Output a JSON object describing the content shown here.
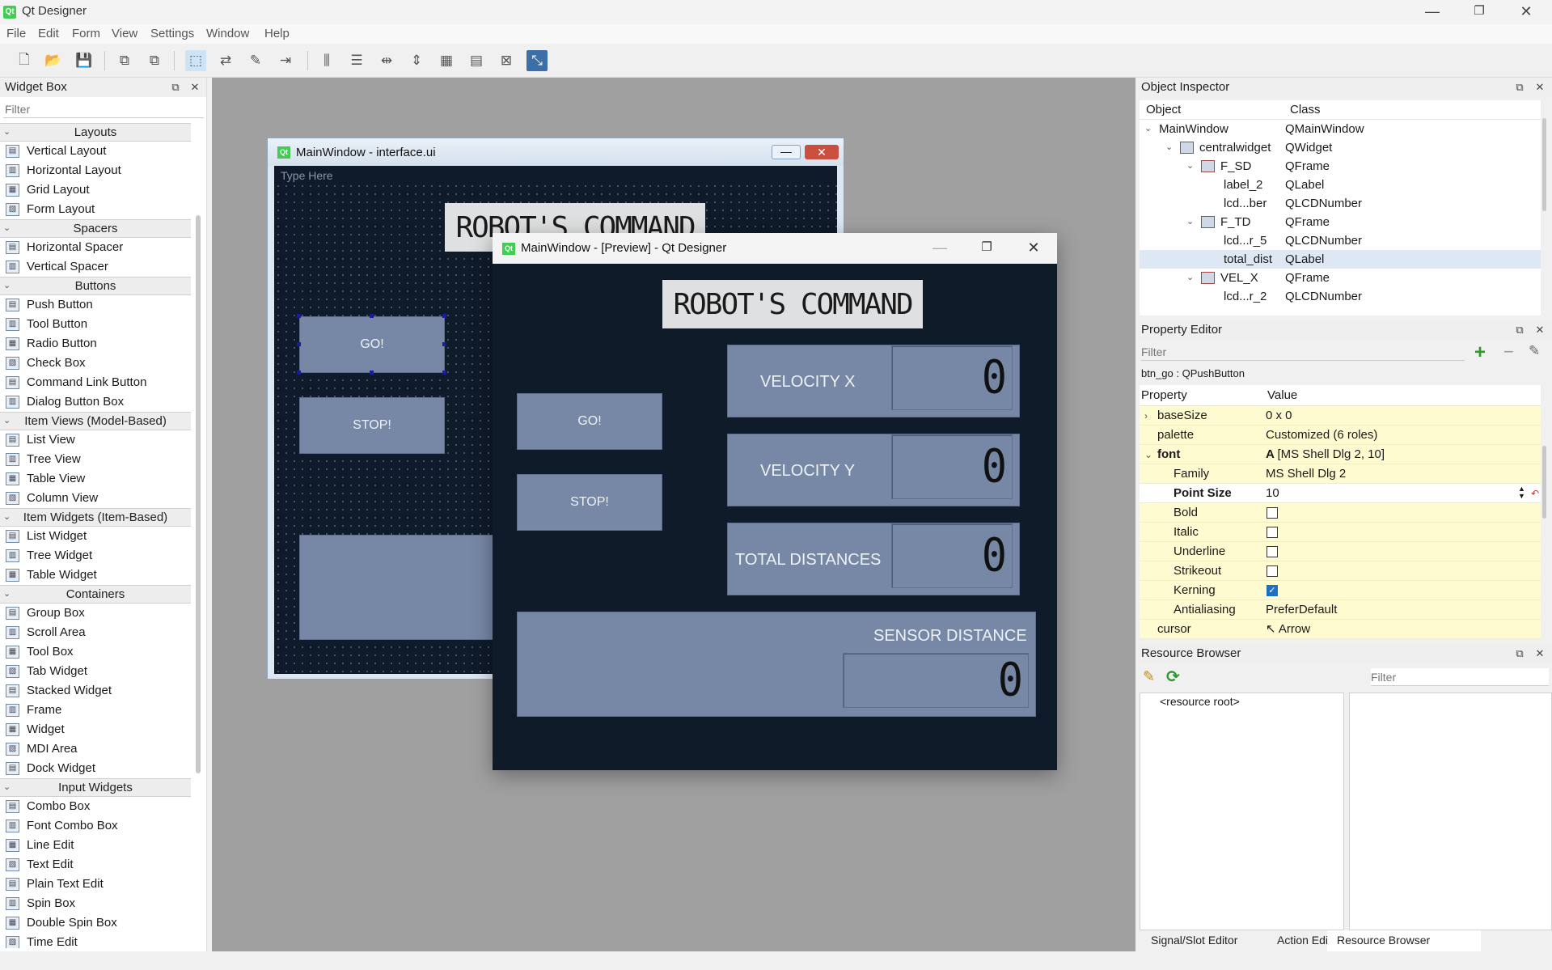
{
  "app": {
    "title": "Qt Designer",
    "logo": "Qt"
  },
  "window_controls": {
    "minimize": "—",
    "maximize": "❐",
    "close": "✕"
  },
  "menu": [
    "File",
    "Edit",
    "Form",
    "View",
    "Settings",
    "Window",
    "Help"
  ],
  "widget_box": {
    "title": "Widget Box",
    "filter_placeholder": "Filter",
    "categories": [
      {
        "name": "Layouts",
        "items": [
          "Vertical Layout",
          "Horizontal Layout",
          "Grid Layout",
          "Form Layout"
        ]
      },
      {
        "name": "Spacers",
        "items": [
          "Horizontal Spacer",
          "Vertical Spacer"
        ]
      },
      {
        "name": "Buttons",
        "items": [
          "Push Button",
          "Tool Button",
          "Radio Button",
          "Check Box",
          "Command Link Button",
          "Dialog Button Box"
        ]
      },
      {
        "name": "Item Views (Model-Based)",
        "items": [
          "List View",
          "Tree View",
          "Table View",
          "Column View"
        ]
      },
      {
        "name": "Item Widgets (Item-Based)",
        "items": [
          "List Widget",
          "Tree Widget",
          "Table Widget"
        ]
      },
      {
        "name": "Containers",
        "items": [
          "Group Box",
          "Scroll Area",
          "Tool Box",
          "Tab Widget",
          "Stacked Widget",
          "Frame",
          "Widget",
          "MDI Area",
          "Dock Widget"
        ]
      },
      {
        "name": "Input Widgets",
        "items": [
          "Combo Box",
          "Font Combo Box",
          "Line Edit",
          "Text Edit",
          "Plain Text Edit",
          "Spin Box",
          "Double Spin Box",
          "Time Edit"
        ]
      }
    ]
  },
  "form_window": {
    "title": "MainWindow - interface.ui",
    "menu_placeholder": "Type Here",
    "header_label": "ROBOT'S COMMAND",
    "go_label": "GO!",
    "stop_label": "STOP!"
  },
  "preview_window": {
    "title": "MainWindow - [Preview] - Qt Designer",
    "header_label": "ROBOT'S COMMAND",
    "go_label": "GO!",
    "stop_label": "STOP!",
    "velocity_x_label": "VELOCITY X",
    "velocity_y_label": "VELOCITY Y",
    "total_distances_label": "TOTAL DISTANCES",
    "sensor_distance_label": "SENSOR DISTANCE",
    "velocity_x_value": "0",
    "velocity_y_value": "0",
    "total_distances_value": "0",
    "sensor_distance_value": "0"
  },
  "object_inspector": {
    "title": "Object Inspector",
    "col_object": "Object",
    "col_class": "Class",
    "rows": [
      {
        "object": "MainWindow",
        "class": "QMainWindow"
      },
      {
        "object": "centralwidget",
        "class": "QWidget"
      },
      {
        "object": "F_SD",
        "class": "QFrame"
      },
      {
        "object": "label_2",
        "class": "QLabel"
      },
      {
        "object": "lcd...ber",
        "class": "QLCDNumber"
      },
      {
        "object": "F_TD",
        "class": "QFrame"
      },
      {
        "object": "lcd...r_5",
        "class": "QLCDNumber"
      },
      {
        "object": "total_dist",
        "class": "QLabel"
      },
      {
        "object": "VEL_X",
        "class": "QFrame"
      },
      {
        "object": "lcd...r_2",
        "class": "QLCDNumber"
      }
    ]
  },
  "property_editor": {
    "title": "Property Editor",
    "filter_placeholder": "Filter",
    "selected": "btn_go : QPushButton",
    "col_property": "Property",
    "col_value": "Value",
    "rows": [
      {
        "name": "baseSize",
        "value": "0 x 0"
      },
      {
        "name": "palette",
        "value": "Customized (6 roles)"
      },
      {
        "name": "font",
        "value": "[MS Shell Dlg 2, 10]"
      },
      {
        "name": "Family",
        "value": "MS Shell Dlg 2"
      },
      {
        "name": "Point Size",
        "value": "10"
      },
      {
        "name": "Bold",
        "value": ""
      },
      {
        "name": "Italic",
        "value": ""
      },
      {
        "name": "Underline",
        "value": ""
      },
      {
        "name": "Strikeout",
        "value": ""
      },
      {
        "name": "Kerning",
        "value": ""
      },
      {
        "name": "Antialiasing",
        "value": "PreferDefault"
      },
      {
        "name": "cursor",
        "value": "Arrow"
      }
    ]
  },
  "resource_browser": {
    "title": "Resource Browser",
    "filter_placeholder": "Filter",
    "root": "<resource root>"
  },
  "bottom_tabs": [
    "Signal/Slot Editor",
    "Action Editor",
    "Resource Browser"
  ]
}
